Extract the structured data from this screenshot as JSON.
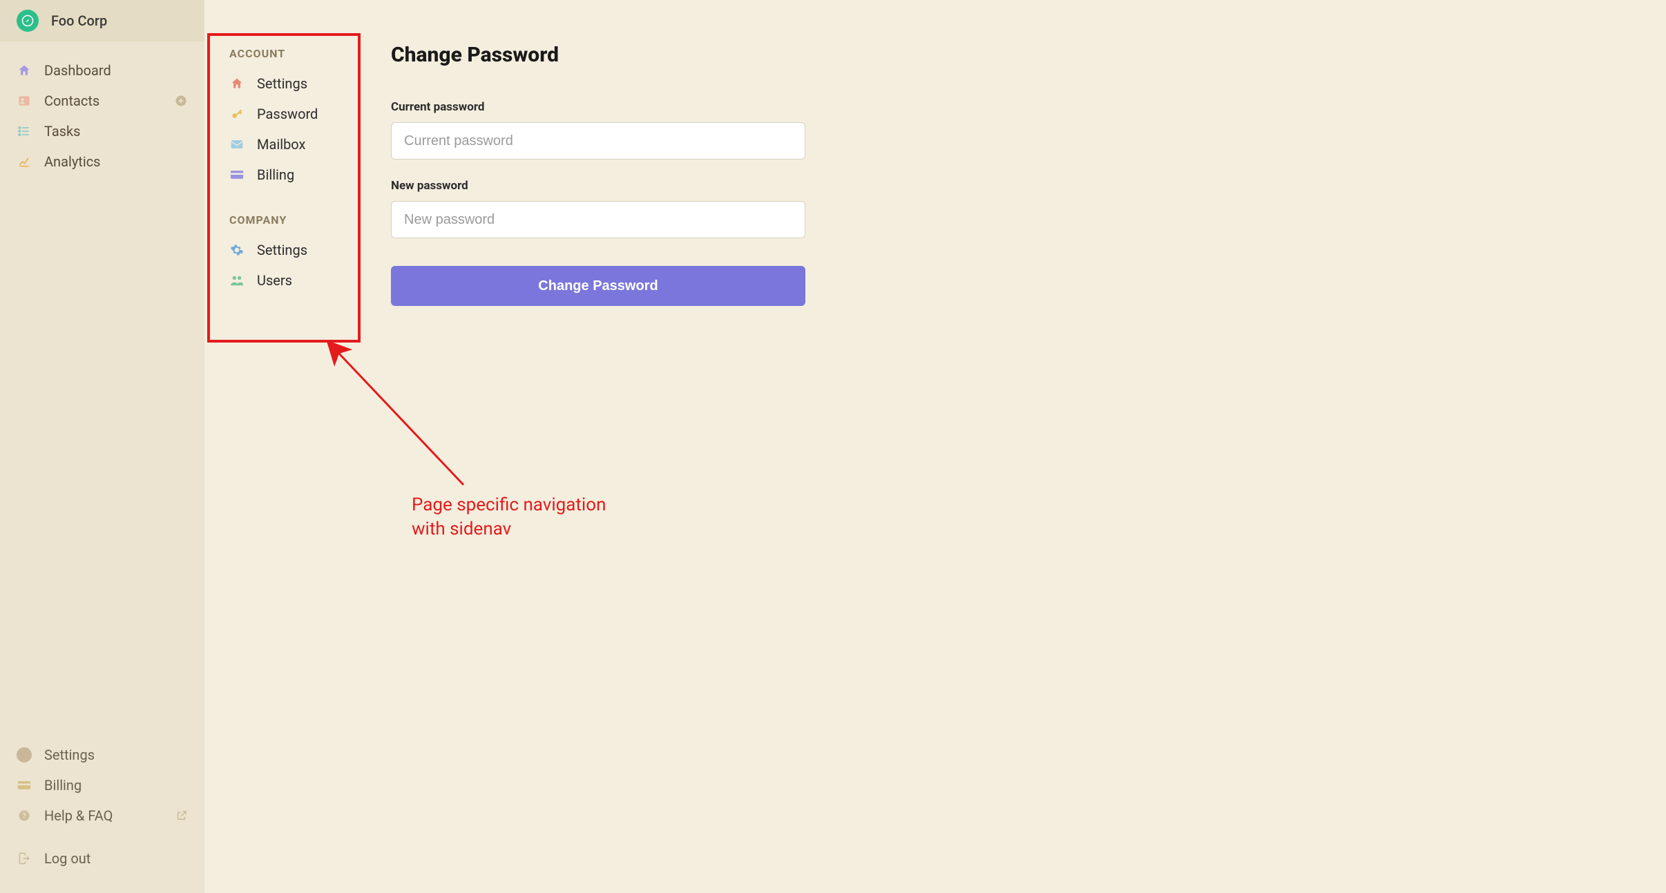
{
  "brand": {
    "title": "Foo Corp"
  },
  "sidebar": {
    "top": [
      {
        "label": "Dashboard"
      },
      {
        "label": "Contacts"
      },
      {
        "label": "Tasks"
      },
      {
        "label": "Analytics"
      }
    ],
    "bottom": [
      {
        "label": "Settings"
      },
      {
        "label": "Billing"
      },
      {
        "label": "Help & FAQ"
      },
      {
        "label": "Log out"
      }
    ]
  },
  "subnav": {
    "groups": [
      {
        "title": "ACCOUNT",
        "items": [
          {
            "label": "Settings"
          },
          {
            "label": "Password"
          },
          {
            "label": "Mailbox"
          },
          {
            "label": "Billing"
          }
        ]
      },
      {
        "title": "COMPANY",
        "items": [
          {
            "label": "Settings"
          },
          {
            "label": "Users"
          }
        ]
      }
    ]
  },
  "page": {
    "title": "Change Password",
    "fields": {
      "current": {
        "label": "Current password",
        "placeholder": "Current password"
      },
      "new": {
        "label": "New password",
        "placeholder": "New password"
      }
    },
    "submit_label": "Change Password"
  },
  "annotation": {
    "text": "Page specific navigation\nwith sidenav"
  },
  "colors": {
    "accent": "#7a76db",
    "brand_green": "#2bbf8a",
    "annotation_red": "#e41b1b"
  }
}
